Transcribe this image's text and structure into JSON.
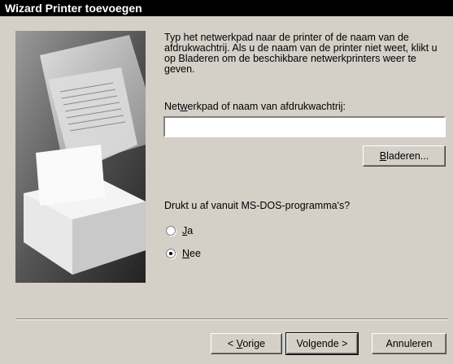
{
  "window": {
    "title": "Wizard Printer toevoegen"
  },
  "instructions": "Typ het netwerkpad naar de printer of de naam van de afdrukwachtrij. Als u de naam van de printer niet weet, klikt u op Bladeren om de beschikbare netwerkprinters weer te geven.",
  "path_field": {
    "label_pre": "Net",
    "label_key": "w",
    "label_post": "erkpad of naam van afdrukwachtrij:",
    "value": ""
  },
  "browse_button": {
    "key": "B",
    "rest": "laderen..."
  },
  "dos_question": "Drukt u af vanuit MS-DOS-programma's?",
  "radio_options": [
    {
      "key": "J",
      "rest": "a",
      "checked": false
    },
    {
      "key": "N",
      "rest": "ee",
      "checked": true
    }
  ],
  "buttons": {
    "back_pre": "< ",
    "back_key": "V",
    "back_rest": "orige",
    "next": "Volgende >",
    "cancel": "Annuleren"
  }
}
